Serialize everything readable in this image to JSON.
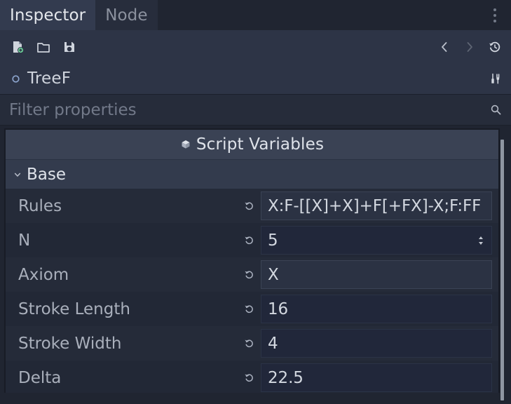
{
  "window": {
    "tabs": [
      {
        "label": "Inspector",
        "active": true
      },
      {
        "label": "Node",
        "active": false
      }
    ],
    "overflow_menu_icon": "kebab-menu-icon"
  },
  "toolbar": {
    "left_buttons": [
      {
        "name": "new-resource-button",
        "icon": "new-file-icon"
      },
      {
        "name": "load-resource-button",
        "icon": "folder-open-icon"
      },
      {
        "name": "save-resource-button",
        "icon": "floppy-save-icon"
      }
    ],
    "right_buttons": [
      {
        "name": "history-back-button",
        "icon": "chevron-left-icon"
      },
      {
        "name": "history-forward-button",
        "icon": "chevron-right-icon"
      },
      {
        "name": "history-button",
        "icon": "history-clock-icon"
      }
    ]
  },
  "node": {
    "name": "TreeF",
    "icon": "node2d-icon",
    "tools_icon": "object-tools-icon"
  },
  "search": {
    "placeholder": "Filter properties",
    "value": "",
    "icon": "search-icon"
  },
  "inspector": {
    "category": {
      "title": "Script Variables",
      "icon": "script-object-icon"
    },
    "sections": [
      {
        "label": "Base",
        "expanded": true,
        "chevron": "chevron-down-icon"
      }
    ],
    "properties": [
      {
        "label": "Rules",
        "value": "X:F-[[X]+X]+F[+FX]-X;F:FF",
        "type": "text",
        "revert_icon": "revert-arrow-icon"
      },
      {
        "label": "N",
        "value": "5",
        "type": "number",
        "revert_icon": "revert-arrow-icon",
        "spinner_icon": "spinner-updown-icon"
      },
      {
        "label": "Axiom",
        "value": "X",
        "type": "text",
        "revert_icon": "revert-arrow-icon"
      },
      {
        "label": "Stroke Length",
        "value": "16",
        "type": "number",
        "revert_icon": "revert-arrow-icon"
      },
      {
        "label": "Stroke Width",
        "value": "4",
        "type": "number",
        "revert_icon": "revert-arrow-icon"
      },
      {
        "label": "Delta",
        "value": "22.5",
        "type": "number",
        "revert_icon": "revert-arrow-icon"
      }
    ]
  },
  "colors": {
    "window_bg": "#202531",
    "tab_active_bg": "#333b4f",
    "tab_inactive_bg": "#272d3c",
    "toolbar_bg": "#2d3446",
    "category_bg": "#3a4254",
    "section_bg": "#333b4d",
    "text_primary": "#dfe3ea",
    "text_secondary": "#a9afbb",
    "accent_green": "#6ed39a",
    "node_icon_blue": "#8da5cf",
    "scrollbar_thumb": "#8e95a1"
  }
}
